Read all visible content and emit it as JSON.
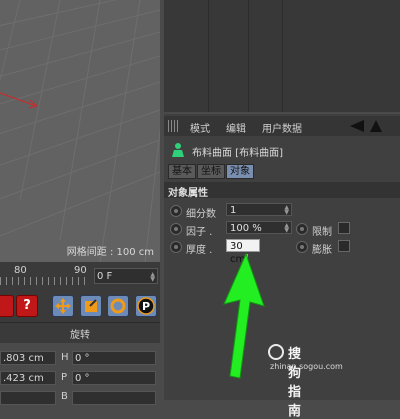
{
  "viewport": {
    "grid_spacing": "网格间距 : 100 cm"
  },
  "attributes": {
    "menu": [
      "模式",
      "编辑",
      "用户数据"
    ],
    "object_name": "布料曲面 [布料曲面]",
    "tabs": [
      "基本",
      "坐标",
      "对象"
    ],
    "active_tab": "对象",
    "section_title": "对象属性",
    "params": [
      {
        "label": "细分数",
        "value": "1"
      },
      {
        "label": "因子 .",
        "value": "100 %"
      },
      {
        "label": "厚度 .",
        "value": "30 cm"
      }
    ],
    "options": [
      {
        "label": "限制"
      },
      {
        "label": "膨胀"
      }
    ]
  },
  "timeline": {
    "tick_80": "80",
    "tick_90": "90",
    "frame": "0 F"
  },
  "coordinates": {
    "rotation_header": "旋转",
    "position_values": [
      ".803 cm",
      ".423 cm"
    ],
    "rotation_axes": [
      "H",
      "P",
      "B"
    ],
    "rotation_values": [
      "0 °",
      "0 °"
    ]
  },
  "watermark": {
    "brand": "搜狗指南",
    "url": "zhinan.sogou.com"
  },
  "colors": {
    "annotation_arrow": "#22ee22",
    "axis_red": "#c03030"
  }
}
